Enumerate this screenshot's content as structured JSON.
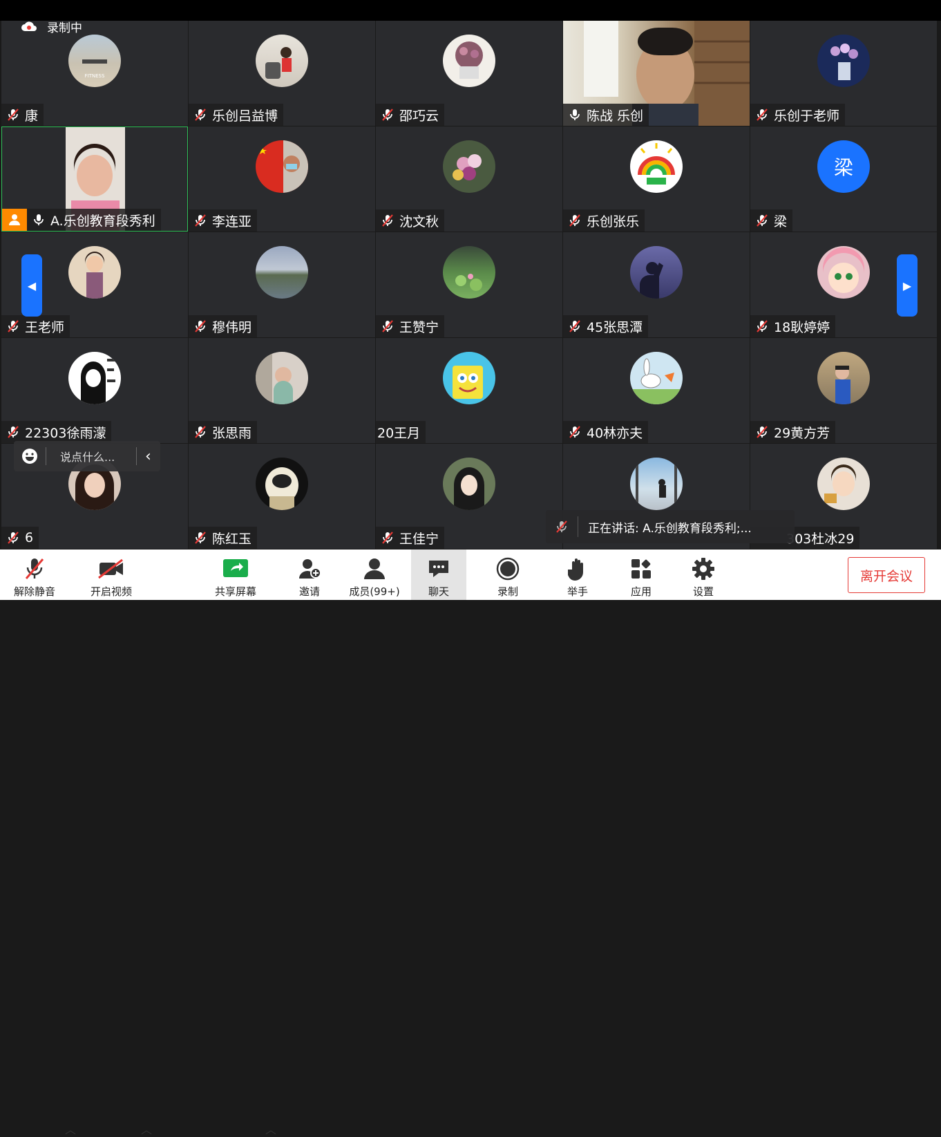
{
  "recording": {
    "label": "录制中"
  },
  "participants": [
    {
      "name": "康",
      "muted": true
    },
    {
      "name": "乐创吕益博",
      "muted": true
    },
    {
      "name": "邵巧云",
      "muted": true
    },
    {
      "name": "陈战  乐创",
      "muted": false,
      "video": true
    },
    {
      "name": "乐创于老师",
      "muted": true
    },
    {
      "name": "A.乐创教育段秀利",
      "muted": false,
      "video": true,
      "host": true,
      "active": true
    },
    {
      "name": "李连亚",
      "muted": true
    },
    {
      "name": "沈文秋",
      "muted": true
    },
    {
      "name": "乐创张乐",
      "muted": true
    },
    {
      "name": "梁",
      "muted": true,
      "avatar_letter": "梁"
    },
    {
      "name": "王老师",
      "muted": true
    },
    {
      "name": "穆伟明",
      "muted": true
    },
    {
      "name": "王赞宁",
      "muted": true
    },
    {
      "name": "45张思潭",
      "muted": true
    },
    {
      "name": "18耿婷婷",
      "muted": true
    },
    {
      "name": "22303徐雨濛",
      "muted": true
    },
    {
      "name": "张思雨",
      "muted": true
    },
    {
      "name": "20王月",
      "muted": false,
      "no_mic_icon": true
    },
    {
      "name": "40林亦夫",
      "muted": true
    },
    {
      "name": "29黄方芳",
      "muted": true
    },
    {
      "name": "6",
      "muted": true
    },
    {
      "name": "陈红玉",
      "muted": true
    },
    {
      "name": "王佳宁",
      "muted": true
    },
    {
      "name": "",
      "muted": false,
      "no_mic_icon": true
    },
    {
      "name": "303杜冰29",
      "muted": false,
      "no_mic_icon": true
    }
  ],
  "chat_input": {
    "placeholder": "说点什么..."
  },
  "speaking": {
    "text": "正在讲话: A.乐创教育段秀利;..."
  },
  "toolbar": {
    "unmute": "解除静音",
    "start_video": "开启视频",
    "share_screen": "共享屏幕",
    "invite": "邀请",
    "members": "成员(99+)",
    "chat": "聊天",
    "record": "录制",
    "raise_hand": "举手",
    "apps": "应用",
    "settings": "设置",
    "leave": "离开会议"
  },
  "colors": {
    "accent": "#1a73ff",
    "leave": "#e53935",
    "active_border": "#32c35b",
    "share_green": "#1aad4b"
  }
}
